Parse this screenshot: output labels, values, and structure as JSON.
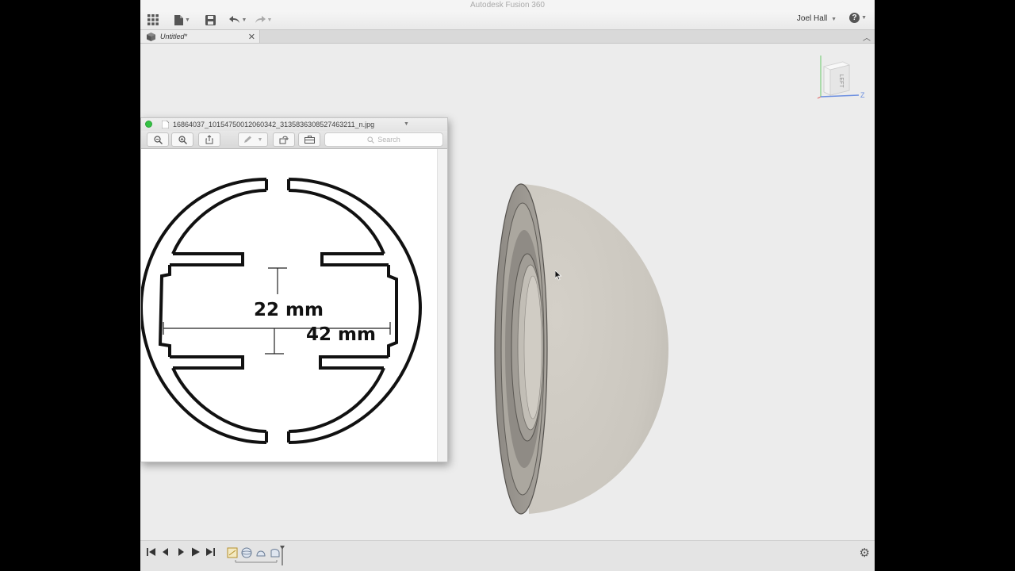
{
  "app": {
    "title": "Autodesk Fusion 360"
  },
  "user": {
    "name": "Joel Hall"
  },
  "tab": {
    "title": "Untitled*"
  },
  "viewcube": {
    "face": "LEFT",
    "axis_z": "Z"
  },
  "viewer": {
    "filename": "16864037_10154750012060342_3135836308527463211_n.jpg",
    "search_placeholder": "Search"
  },
  "drawing": {
    "dim_inner": "22 mm",
    "dim_outer": "42 mm"
  },
  "colors": {
    "model_face": "#cfcbc3",
    "viewport_bg": "#ececec",
    "traffic_green": "#35c244"
  },
  "icons": {
    "grid": "grid-icon",
    "file": "file-icon",
    "save": "save-icon",
    "undo": "undo-icon",
    "redo": "redo-icon",
    "help": "help-icon",
    "close": "close-icon",
    "settings": "gear-icon"
  }
}
